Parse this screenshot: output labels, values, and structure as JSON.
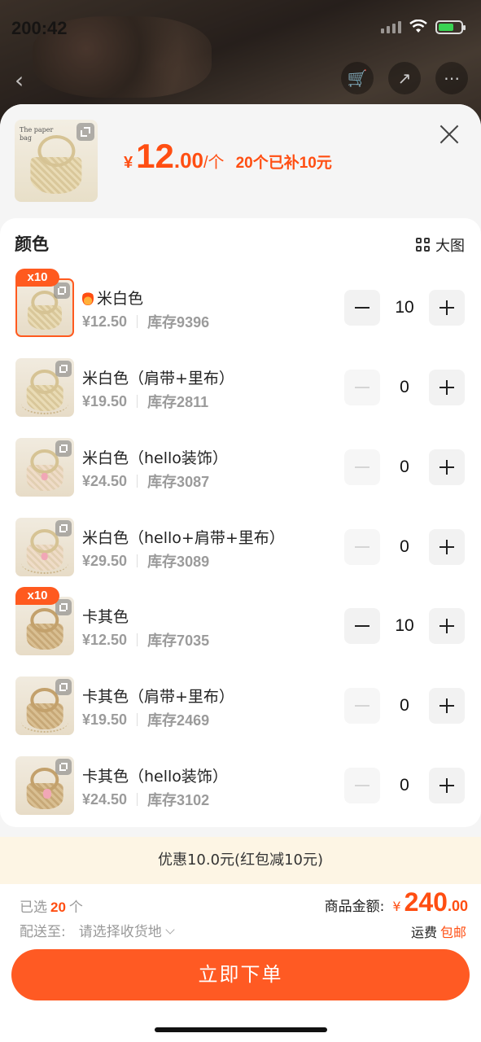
{
  "status_bar": {
    "time": "200:42"
  },
  "header": {
    "currency": "¥",
    "price_int": "12",
    "price_dec": ".00",
    "price_unit": "/个",
    "promo": "20个已补10元"
  },
  "variants_section": {
    "title": "颜色",
    "big_image_label": "大图",
    "thumb_text": "The paper bag"
  },
  "variants": [
    {
      "name": "米白色",
      "price": "¥12.50",
      "stock": "库存9396",
      "qty": "10",
      "badge": "x10",
      "hot": true,
      "color": "white",
      "style": "plain"
    },
    {
      "name": "米白色（肩带+里布）",
      "price": "¥19.50",
      "stock": "库存2811",
      "qty": "0",
      "badge": "",
      "hot": false,
      "color": "white",
      "style": "strap"
    },
    {
      "name": "米白色（hello装饰）",
      "price": "¥24.50",
      "stock": "库存3087",
      "qty": "0",
      "badge": "",
      "hot": false,
      "color": "pink",
      "style": "plain"
    },
    {
      "name": "米白色（hello+肩带+里布）",
      "price": "¥29.50",
      "stock": "库存3089",
      "qty": "0",
      "badge": "",
      "hot": false,
      "color": "pink",
      "style": "strap"
    },
    {
      "name": "卡其色",
      "price": "¥12.50",
      "stock": "库存7035",
      "qty": "10",
      "badge": "x10",
      "hot": false,
      "color": "khaki",
      "style": "plain"
    },
    {
      "name": "卡其色（肩带+里布）",
      "price": "¥19.50",
      "stock": "库存2469",
      "qty": "0",
      "badge": "",
      "hot": false,
      "color": "khaki",
      "style": "strap"
    },
    {
      "name": "卡其色（hello装饰）",
      "price": "¥24.50",
      "stock": "库存3102",
      "qty": "0",
      "badge": "",
      "hot": false,
      "color": "khaki-pink",
      "style": "plain"
    }
  ],
  "discount": {
    "text": "优惠10.0元(红包减10元)"
  },
  "footer": {
    "selected_prefix": "已选",
    "selected_count": "20",
    "selected_suffix": "个",
    "ship_label": "配送至:",
    "ship_value": "请选择收货地",
    "amount_label": "商品金额:",
    "amount_currency": "¥",
    "amount_int": "240",
    "amount_dec": ".00",
    "freight_label": "运费",
    "freight_value": "包邮",
    "order_button": "立即下单"
  },
  "colors": {
    "accent": "#ff5a23",
    "price": "#ff4e12",
    "discount_bg": "#fdf5e4"
  }
}
